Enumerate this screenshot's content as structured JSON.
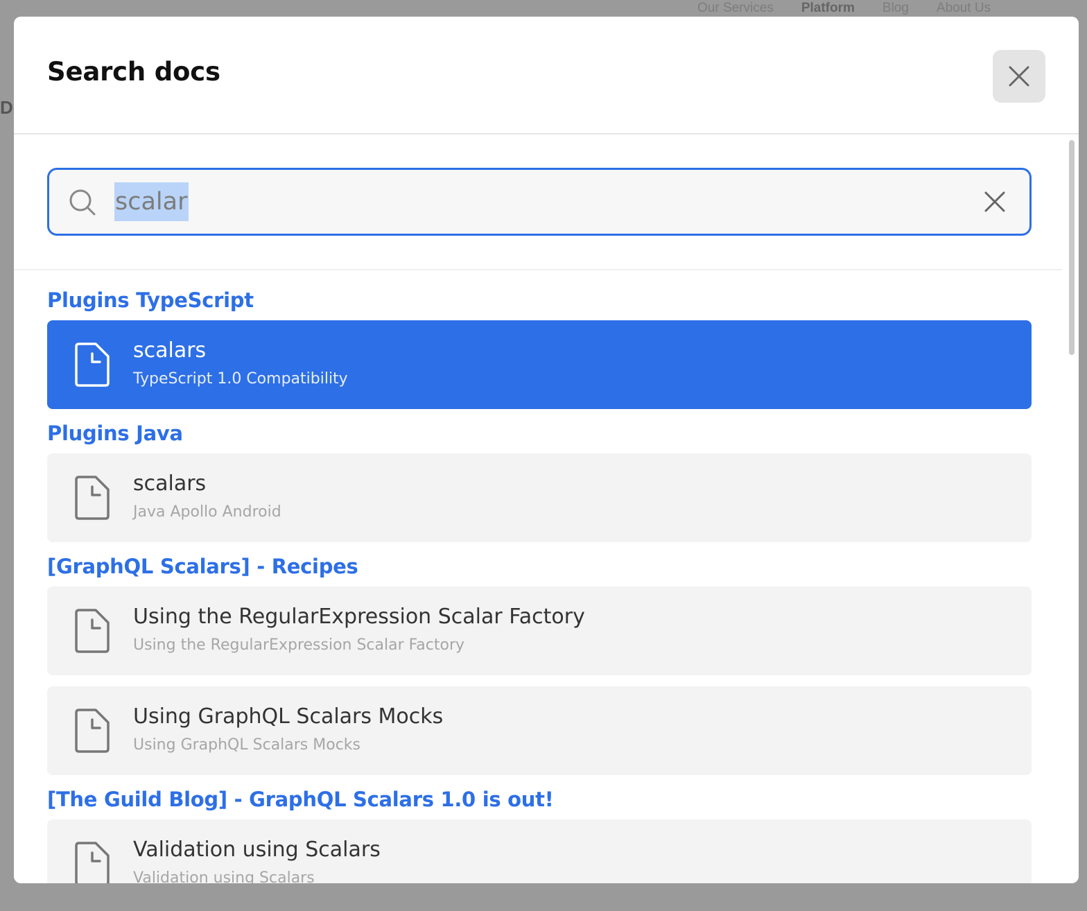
{
  "background": {
    "nav_items": [
      "Our Services",
      "Platform",
      "Blog",
      "About Us"
    ],
    "peek_text": "Do"
  },
  "modal": {
    "title": "Search docs",
    "close_icon": "close-icon"
  },
  "search": {
    "value": "scalar",
    "icon": "search-icon",
    "clear_icon": "clear-icon"
  },
  "groups": [
    {
      "heading": "Plugins TypeScript",
      "results": [
        {
          "title": "scalars",
          "subtitle": "TypeScript 1.0 Compatibility",
          "active": true,
          "icon": "document-icon"
        }
      ]
    },
    {
      "heading": "Plugins Java",
      "results": [
        {
          "title": "scalars",
          "subtitle": "Java Apollo Android",
          "active": false,
          "icon": "document-icon"
        }
      ]
    },
    {
      "heading": "[GraphQL Scalars] - Recipes",
      "results": [
        {
          "title": "Using the RegularExpression Scalar Factory",
          "subtitle": "Using the RegularExpression Scalar Factory",
          "active": false,
          "icon": "document-icon"
        },
        {
          "title": "Using GraphQL Scalars Mocks",
          "subtitle": "Using GraphQL Scalars Mocks",
          "active": false,
          "icon": "document-icon"
        }
      ]
    },
    {
      "heading": "[The Guild Blog] - GraphQL Scalars 1.0 is out!",
      "results": [
        {
          "title": "Validation using Scalars",
          "subtitle": "Validation using Scalars",
          "active": false,
          "icon": "document-icon"
        }
      ]
    }
  ],
  "colors": {
    "accent": "#2d6fe6",
    "result_bg": "#f3f3f3",
    "overlay": "#9a9a9a"
  }
}
